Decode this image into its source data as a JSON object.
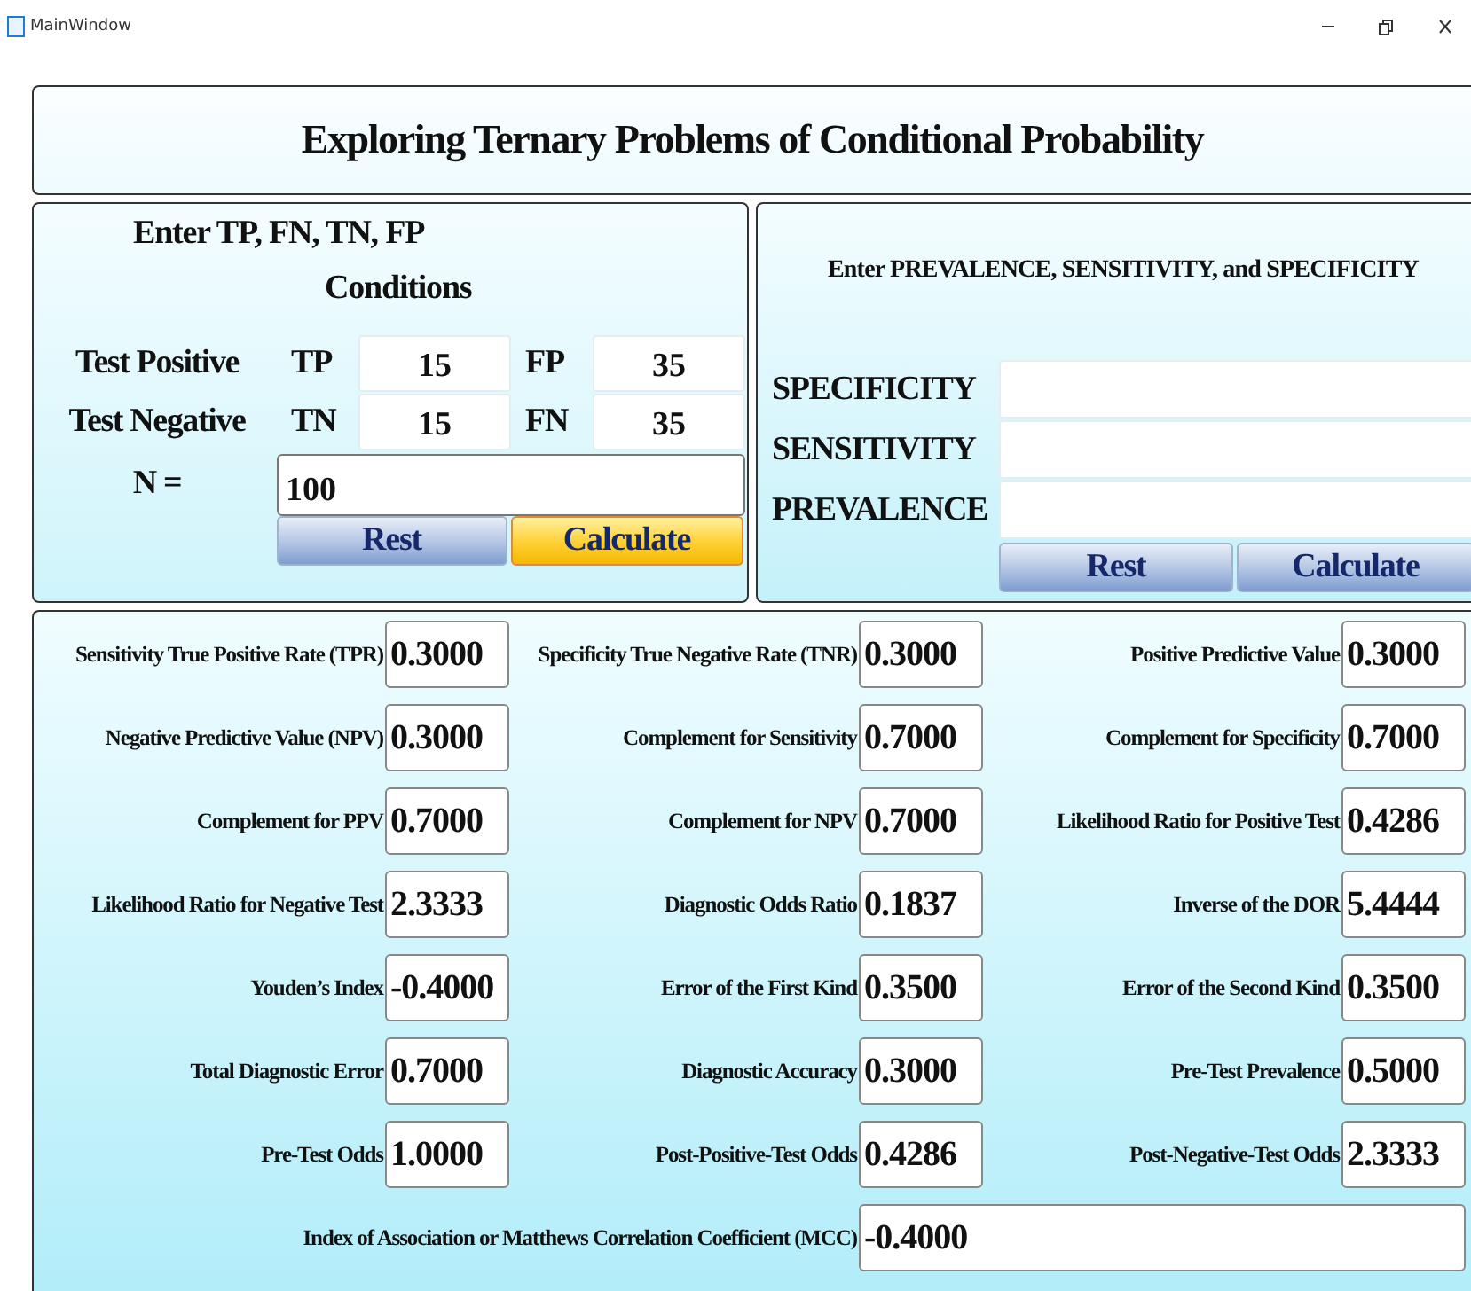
{
  "window": {
    "title": "MainWindow"
  },
  "header": {
    "title": "Exploring Ternary Problems of Conditional Probability"
  },
  "counts_panel": {
    "title": "Enter TP, FN, TN, FP",
    "column_header": "Conditions",
    "rows": [
      {
        "label": "Test Positive",
        "cells": [
          {
            "label": "TP",
            "value": "15"
          },
          {
            "label": "FP",
            "value": "35"
          }
        ]
      },
      {
        "label": "Test Negative",
        "cells": [
          {
            "label": "TN",
            "value": "15"
          },
          {
            "label": "FN",
            "value": "35"
          }
        ]
      }
    ],
    "n_label": "N =",
    "n_value": "100",
    "buttons": [
      {
        "label": "Rest",
        "highlighted": false
      },
      {
        "label": "Calculate",
        "highlighted": true
      }
    ]
  },
  "rates_panel": {
    "title": "Enter PREVALENCE, SENSITIVITY, and SPECIFICITY",
    "fields": [
      {
        "label": "SPECIFICITY"
      },
      {
        "label": "SENSITIVITY"
      },
      {
        "label": "PREVALENCE"
      }
    ],
    "buttons": [
      {
        "label": "Rest",
        "highlighted": false
      },
      {
        "label": "Calculate",
        "highlighted": false
      }
    ]
  },
  "results": {
    "items": [
      {
        "label": "Sensitivity True Positive Rate (TPR)",
        "value": "0.3000"
      },
      {
        "label": "Specificity True Negative Rate (TNR)",
        "value": "0.3000"
      },
      {
        "label": "Positive Predictive Value",
        "value": "0.3000"
      },
      {
        "label": "Negative Predictive Value (NPV)",
        "value": "0.3000"
      },
      {
        "label": "Complement for Sensitivity",
        "value": "0.7000"
      },
      {
        "label": "Complement for Specificity",
        "value": "0.7000"
      },
      {
        "label": "Complement for PPV",
        "value": "0.7000"
      },
      {
        "label": "Complement for NPV",
        "value": "0.7000"
      },
      {
        "label": "Likelihood Ratio for Positive Test",
        "value": "0.4286"
      },
      {
        "label": "Likelihood Ratio for Negative Test",
        "value": "2.3333"
      },
      {
        "label": "Diagnostic Odds Ratio",
        "value": "0.1837"
      },
      {
        "label": "Inverse of the DOR",
        "value": "5.4444"
      },
      {
        "label": "Youden’s Index",
        "value": "-0.4000"
      },
      {
        "label": "Error of the First Kind",
        "value": "0.3500"
      },
      {
        "label": "Error of the Second Kind",
        "value": "0.3500"
      },
      {
        "label": "Total Diagnostic Error",
        "value": "0.7000"
      },
      {
        "label": "Diagnostic Accuracy",
        "value": "0.3000"
      },
      {
        "label": "Pre-Test Prevalence",
        "value": "0.5000"
      },
      {
        "label": "Pre-Test Odds",
        "value": "1.0000"
      },
      {
        "label": "Post-Positive-Test Odds",
        "value": "0.4286"
      },
      {
        "label": "Post-Negative-Test Odds",
        "value": "2.3333"
      }
    ],
    "mcc": {
      "label": "Index of Association or Matthews Correlation Coefficient (MCC)",
      "value": "-0.4000"
    }
  }
}
